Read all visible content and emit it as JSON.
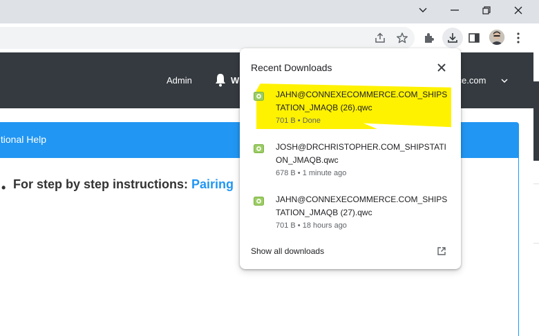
{
  "page": {
    "nav": {
      "admin_label": "Admin",
      "partial_label": "W",
      "account_email_partial": "erce.com"
    },
    "panel": {
      "heading_partial": "ditional Help",
      "step_text": "For step by step instructions: ",
      "step_link": "Pairing"
    }
  },
  "downloads": {
    "title": "Recent Downloads",
    "items": [
      {
        "filename": "JAHN@CONNEXECOMMERCE.COM_SHIPSTATION_JMAQB (26).qwc",
        "status": "701 B • Done"
      },
      {
        "filename": "JOSH@DRCHRISTOPHER.COM_SHIPSTATION_JMAQB.qwc",
        "status": "678 B • 1 minute ago"
      },
      {
        "filename": "JAHN@CONNEXECOMMERCE.COM_SHIPSTATION_JMAQB (27).qwc",
        "status": "701 B • 18 hours ago"
      }
    ],
    "show_all_label": "Show all downloads"
  },
  "icons": {
    "window": [
      "chevron-down-icon",
      "minimize-icon",
      "restore-icon",
      "close-icon"
    ],
    "toolbar": [
      "share-icon",
      "star-icon",
      "extensions-icon",
      "download-icon",
      "side-panel-icon",
      "avatar",
      "more-icon"
    ],
    "file": "qwc-file-icon"
  },
  "colors": {
    "accent": "#2196f3",
    "navbar": "#343a40",
    "highlight": "#fff200",
    "titlebar": "#dee1e6"
  }
}
